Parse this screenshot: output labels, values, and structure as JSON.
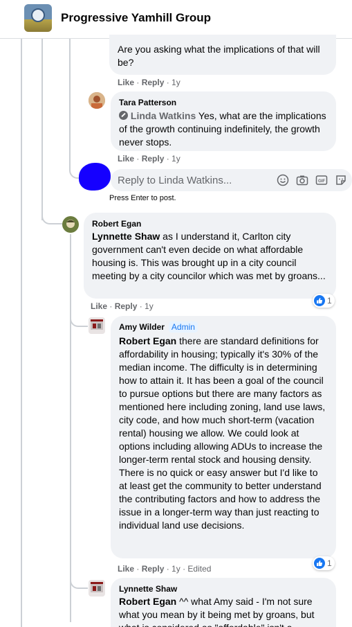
{
  "header": {
    "group_name": "Progressive Yamhill Group"
  },
  "comments": {
    "c0": {
      "text": "Are you asking what the implications of that will be?",
      "like": "Like",
      "reply": "Reply",
      "time": "1y"
    },
    "c1": {
      "author": "Tara Patterson",
      "mention": "Linda Watkins",
      "text": " Yes, what are the implications of the growth continuing indefinitely, the growth never stops.",
      "like": "Like",
      "reply": "Reply",
      "time": "1y"
    },
    "reply_box": {
      "placeholder": "Reply to Linda Watkins...",
      "hint": "Press Enter to post."
    },
    "c2": {
      "author": "Robert Egan",
      "mention": "Lynnette Shaw",
      "text": " as I understand it, Carlton city government can't even decide on what affordable housing is. This was brought up in a city council meeting by a city councilor which was met by groans...",
      "like": "Like",
      "reply": "Reply",
      "time": "1y",
      "reaction_count": "1"
    },
    "c3": {
      "author": "Amy Wilder",
      "badge": "Admin",
      "mention": "Robert Egan",
      "text": " there are standard definitions for affordability in housing; typically it's 30% of the median income. The difficulty is in determining how to attain it. It has been a goal of the council to pursue options but there are many factors as mentioned here including zoning, land use laws, city code, and how much short-term (vacation rental) housing we allow. We could look at options including allowing ADUs to increase the longer-term rental stock and housing density. There is no quick or easy answer but I'd like to at least get the community to better understand the contributing factors and how to address the issue in a longer-term way than just reacting to individual land use decisions.",
      "like": "Like",
      "reply": "Reply",
      "time": "1y",
      "edited": "Edited",
      "reaction_count": "1"
    },
    "c4": {
      "author": "Lynnette Shaw",
      "mention": "Robert Egan",
      "text": " ^^ what Amy said - I'm not sure what you mean by it being met by groans, but what is considered as \"affordable\" isn't a"
    }
  },
  "colors": {
    "accent": "#1877f2",
    "bubble": "#f0f2f5",
    "meta": "#65676b"
  }
}
